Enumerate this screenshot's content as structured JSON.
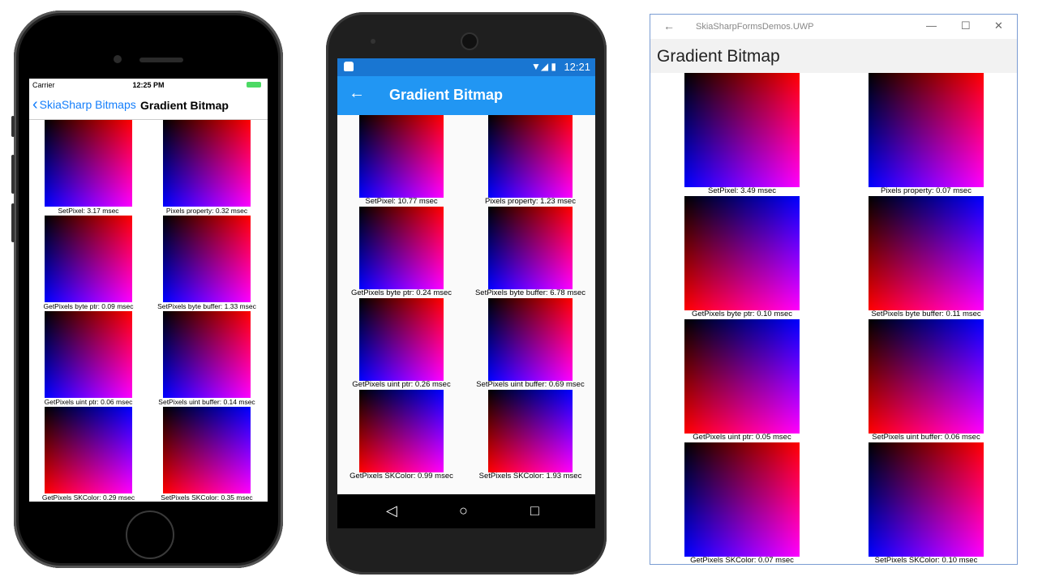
{
  "ios": {
    "status": {
      "carrier": "Carrier",
      "time": "12:25 PM"
    },
    "back_label": "SkiaSharp Bitmaps",
    "title": "Gradient Bitmap",
    "tiles": [
      "SetPixel: 3.17 msec",
      "Pixels property: 0.32 msec",
      "GetPixels byte ptr: 0.09 msec",
      "SetPixels byte buffer: 1.33 msec",
      "GetPixels uint ptr: 0.06 msec",
      "SetPixels uint buffer: 0.14 msec",
      "GetPixels SKColor: 0.29 msec",
      "SetPixels SKColor: 0.35 msec"
    ]
  },
  "android": {
    "status": {
      "time": "12:21"
    },
    "title": "Gradient Bitmap",
    "tiles": [
      "SetPixel: 10.77 msec",
      "Pixels property: 1.23 msec",
      "GetPixels byte ptr: 0.24 msec",
      "SetPixels byte buffer: 6.78 msec",
      "GetPixels uint ptr: 0.26 msec",
      "SetPixels uint buffer: 0.69 msec",
      "GetPixels SKColor: 0.99 msec",
      "SetPixels SKColor: 1.93 msec"
    ]
  },
  "uwp": {
    "app_title": "SkiaSharpFormsDemos.UWP",
    "page_title": "Gradient Bitmap",
    "tiles": [
      "SetPixel: 3.49 msec",
      "Pixels property: 0.07 msec",
      "GetPixels byte ptr: 0.10 msec",
      "SetPixels byte buffer: 0.11 msec",
      "GetPixels uint ptr: 0.05 msec",
      "SetPixels uint buffer: 0.06 msec",
      "GetPixels SKColor: 0.07 msec",
      "SetPixels SKColor: 0.10 msec"
    ]
  }
}
